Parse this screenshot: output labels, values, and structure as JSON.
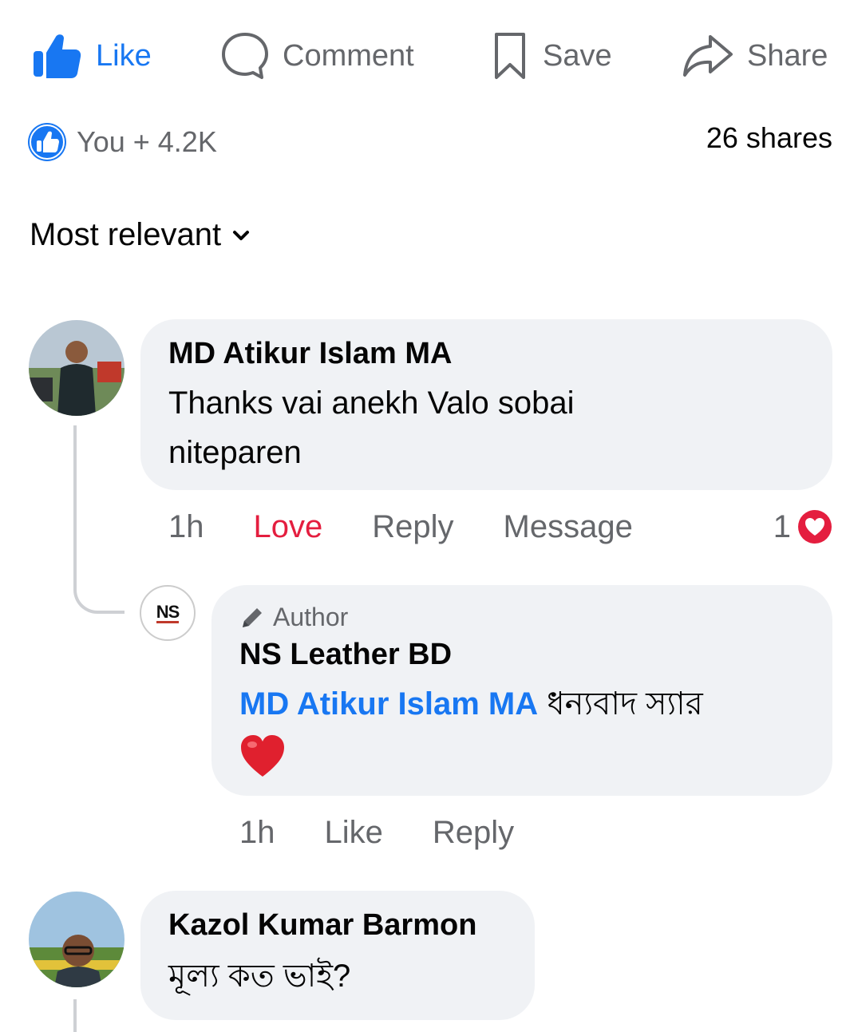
{
  "actions": {
    "like": "Like",
    "comment": "Comment",
    "save": "Save",
    "share": "Share"
  },
  "summary": {
    "reactions": "You + 4.2K",
    "shares": "26 shares"
  },
  "sort": {
    "label": "Most relevant"
  },
  "comments": [
    {
      "author": "MD Atikur Islam MA",
      "text": "Thanks vai anekh Valo sobai niteparen",
      "time": "1h",
      "reaction_label": "Love",
      "reply_label": "Reply",
      "message_label": "Message",
      "reaction_count": "1",
      "reply": {
        "badge": "Author",
        "author": "NS Leather BD",
        "mention": "MD Atikur Islam MA",
        "text": "ধন্যবাদ স্যার",
        "emoji": "❤️",
        "time": "1h",
        "like_label": "Like",
        "reply_label": "Reply",
        "avatar_text": "NS"
      }
    },
    {
      "author": "Kazol Kumar Barmon",
      "text": "মূল্য কত ভাই?"
    }
  ],
  "colors": {
    "accent": "#1877f2",
    "love": "#e41e3f",
    "bubble": "#f0f2f5",
    "secondary_text": "#65676b"
  }
}
